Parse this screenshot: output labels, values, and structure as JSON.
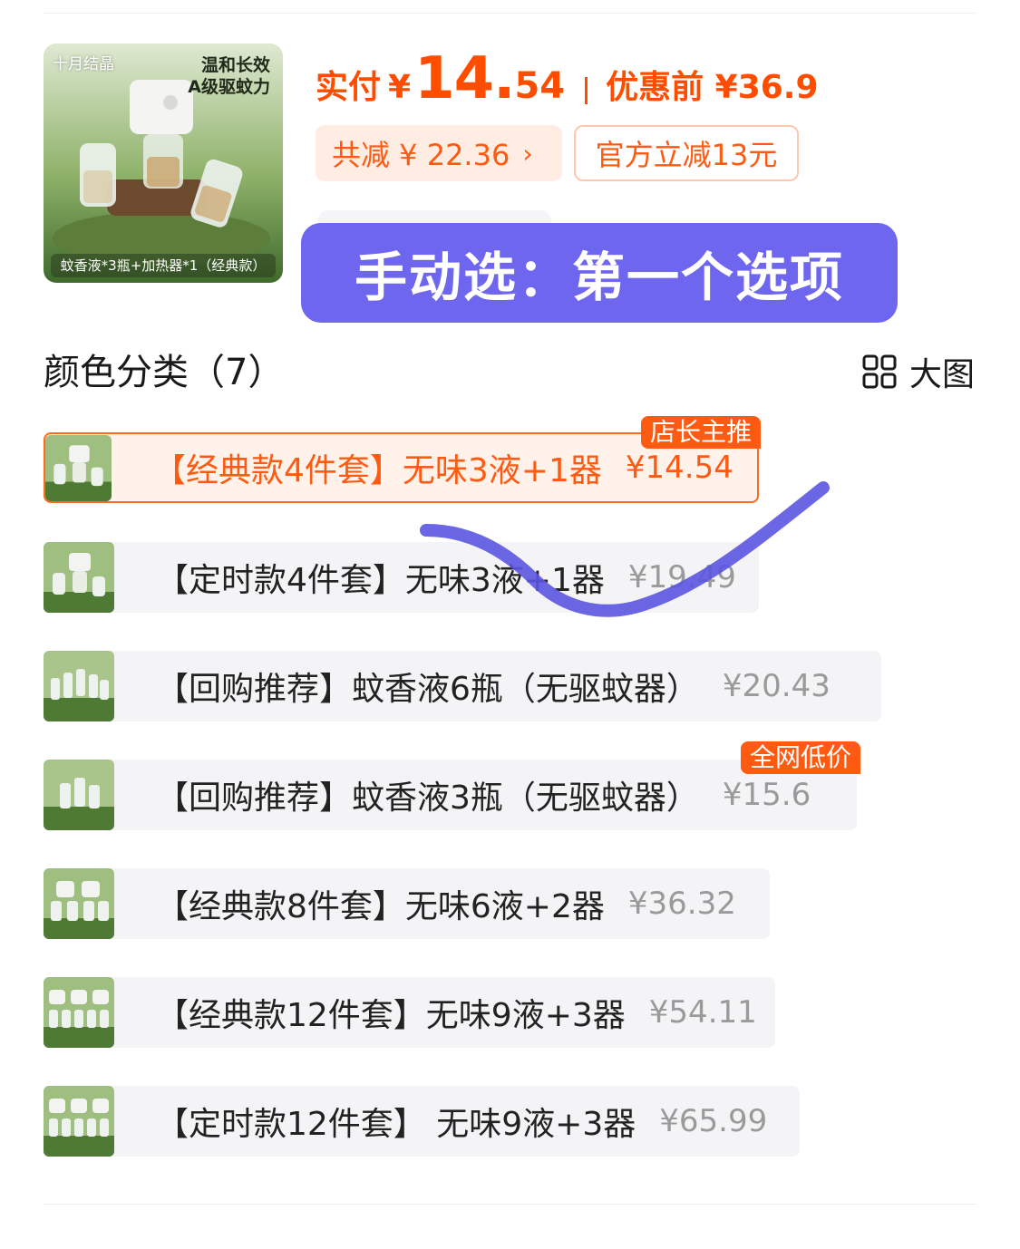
{
  "product": {
    "image": {
      "brand": "十月结晶",
      "slogan_line1": "温和长效",
      "slogan_line2": "A级驱蚊力",
      "caption": "蚊香液*3瓶+加热器*1（经典款）"
    },
    "pay_label": "实付",
    "currency": "¥",
    "price_int": "14.",
    "price_dec": "54",
    "before_label": "优惠前 ¥36.9",
    "total_discount": "共减 ¥ 22.36",
    "total_discount_chevron": "›",
    "official_discount": "官方立减13元",
    "qty_minus": "-",
    "qty_plus": "+"
  },
  "annotation": {
    "banner_text": "手动选：第一个选项"
  },
  "section": {
    "title": "颜色分类（7）",
    "big_view_label": "大图"
  },
  "options": [
    {
      "label": "【经典款4件套】无味3液+1器",
      "price": "¥14.54",
      "tag": "店长主推",
      "selected": true
    },
    {
      "label": "【定时款4件套】无味3液+1器",
      "price": "¥19.49",
      "tag": "",
      "selected": false
    },
    {
      "label": "【回购推荐】蚊香液6瓶（无驱蚊器）",
      "price": "¥20.43",
      "tag": "",
      "selected": false
    },
    {
      "label": "【回购推荐】蚊香液3瓶（无驱蚊器）",
      "price": "¥15.6",
      "tag": "全网低价",
      "selected": false
    },
    {
      "label": "【经典款8件套】无味6液+2器",
      "price": "¥36.32",
      "tag": "",
      "selected": false
    },
    {
      "label": "【经典款12件套】无味9液+3器",
      "price": "¥54.11",
      "tag": "",
      "selected": false
    },
    {
      "label": "【定时款12件套】 无味9液+3器",
      "price": "¥65.99",
      "tag": "",
      "selected": false
    }
  ],
  "colors": {
    "accent": "#ff5a12",
    "banner": "#6f66f0",
    "scribble": "#5b55e0"
  }
}
